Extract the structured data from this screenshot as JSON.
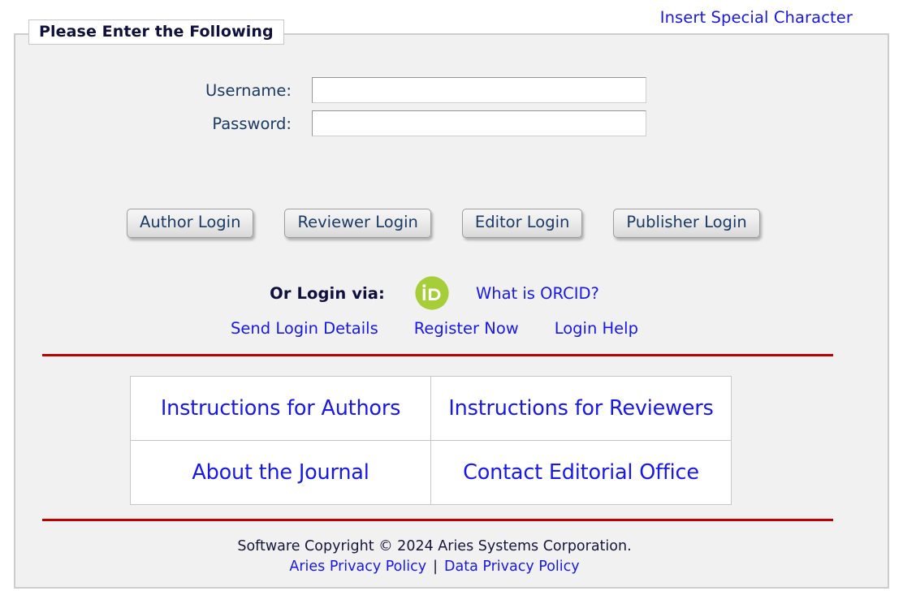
{
  "top": {
    "insert_special_character": "Insert Special Character"
  },
  "panel": {
    "legend": "Please Enter the Following"
  },
  "credentials": {
    "fields": [
      {
        "label": "Username:",
        "value": "",
        "placeholder": "",
        "type": "text"
      },
      {
        "label": "Password:",
        "value": "",
        "placeholder": "",
        "type": "password"
      }
    ]
  },
  "login_buttons": [
    {
      "label": "Author Login"
    },
    {
      "label": "Reviewer Login"
    },
    {
      "label": "Editor Login"
    },
    {
      "label": "Publisher Login"
    }
  ],
  "orcid": {
    "label": "Or Login via:",
    "icon": "orcid-id-icon",
    "what_is_link": "What is ORCID?",
    "icon_color": "#a6ce39",
    "icon_text": "iD"
  },
  "account_links": [
    {
      "label": "Send Login Details"
    },
    {
      "label": "Register Now"
    },
    {
      "label": "Login Help"
    }
  ],
  "nav_table": {
    "rows": [
      [
        {
          "label": "Instructions for Authors"
        },
        {
          "label": "Instructions for Reviewers"
        }
      ],
      [
        {
          "label": "About the Journal"
        },
        {
          "label": "Contact Editorial Office"
        }
      ]
    ]
  },
  "footer": {
    "copyright": "Software Copyright © 2024 Aries Systems Corporation.",
    "privacy_link": "Aries Privacy Policy",
    "separator": "|",
    "data_privacy_link": "Data Privacy Policy"
  },
  "colors": {
    "link_blue": "#1818e8",
    "label_navy": "#1b3a64",
    "heading_navy": "#10103c",
    "rule_red": "#bd0000",
    "panel_bg": "#f1f1f1"
  }
}
